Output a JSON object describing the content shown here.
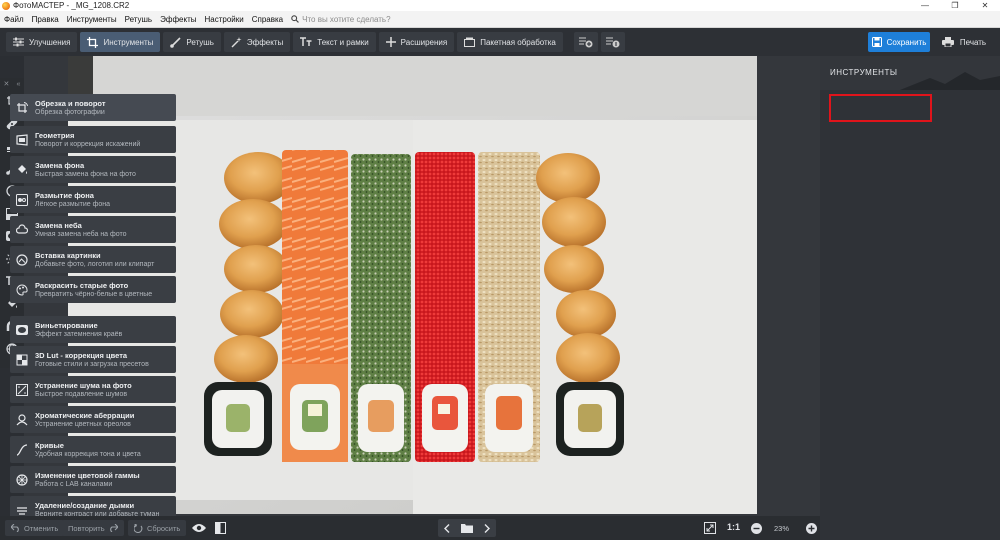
{
  "window": {
    "title": "ФотоМАСТЕР - _MG_1208.CR2",
    "minimize": "—",
    "maximize": "❐",
    "close": "✕"
  },
  "menu": {
    "items": [
      "Файл",
      "Правка",
      "Инструменты",
      "Ретушь",
      "Эффекты",
      "Настройки",
      "Справка"
    ],
    "search_placeholder": "Что вы хотите сделать?"
  },
  "toolbar": {
    "tabs": [
      "Улучшения",
      "Инструменты",
      "Ретушь",
      "Эффекты",
      "Текст и рамки",
      "Расширения",
      "Пакетная обработка"
    ],
    "active_tab": "Инструменты",
    "save_label": "Сохранить",
    "print_label": "Печать"
  },
  "left_tools": {
    "collapse": "✕",
    "expand": "«"
  },
  "right_panel": {
    "header": "ИНСТРУМЕНТЫ",
    "items": [
      {
        "title": "Обрезка и поворот",
        "subtitle": "Обрезка фотографии",
        "icon": "crop-rotate-icon"
      },
      {
        "title": "Геометрия",
        "subtitle": "Поворот и коррекция искажений",
        "icon": "geometry-icon"
      },
      {
        "title": "Замена фона",
        "subtitle": "Быстрая замена фона на фото",
        "icon": "bucket-icon"
      },
      {
        "title": "Размытие фона",
        "subtitle": "Лёгкое размытие фона",
        "icon": "blur-icon"
      },
      {
        "title": "Замена неба",
        "subtitle": "Умная замена неба на фото",
        "icon": "cloud-icon"
      },
      {
        "title": "Вставка картинки",
        "subtitle": "Добавьте фото, логотип или клипарт",
        "icon": "insert-image-icon"
      },
      {
        "title": "Раскрасить старые фото",
        "subtitle": "Превратить чёрно-белые в цветные",
        "icon": "palette-icon"
      },
      {
        "title": "Виньетирование",
        "subtitle": "Эффект затемнения краёв",
        "icon": "vignette-icon"
      },
      {
        "title": "3D Lut - коррекция цвета",
        "subtitle": "Готовые стили и загрузка пресетов",
        "icon": "lut-icon"
      },
      {
        "title": "Устранение шума на фото",
        "subtitle": "Быстрое подавление шумов",
        "icon": "denoise-icon"
      },
      {
        "title": "Хроматические аберрации",
        "subtitle": "Устранение цветных ореолов",
        "icon": "aberration-icon"
      },
      {
        "title": "Кривые",
        "subtitle": "Удобная коррекция тона и цвета",
        "icon": "curves-icon"
      },
      {
        "title": "Изменение цветовой гаммы",
        "subtitle": "Работа с LAB каналами",
        "icon": "color-wheel-icon"
      },
      {
        "title": "Удаление/создание дымки",
        "subtitle": "Верните контраст или добавьте туман",
        "icon": "haze-icon"
      }
    ]
  },
  "bottom": {
    "undo_label": "Отменить",
    "redo_label": "Повторить",
    "reset_label": "Сбросить",
    "ratio": "1:1",
    "zoom": "23%"
  },
  "colors": {
    "accent": "#1e7fd9",
    "highlight": "#e0141b"
  }
}
